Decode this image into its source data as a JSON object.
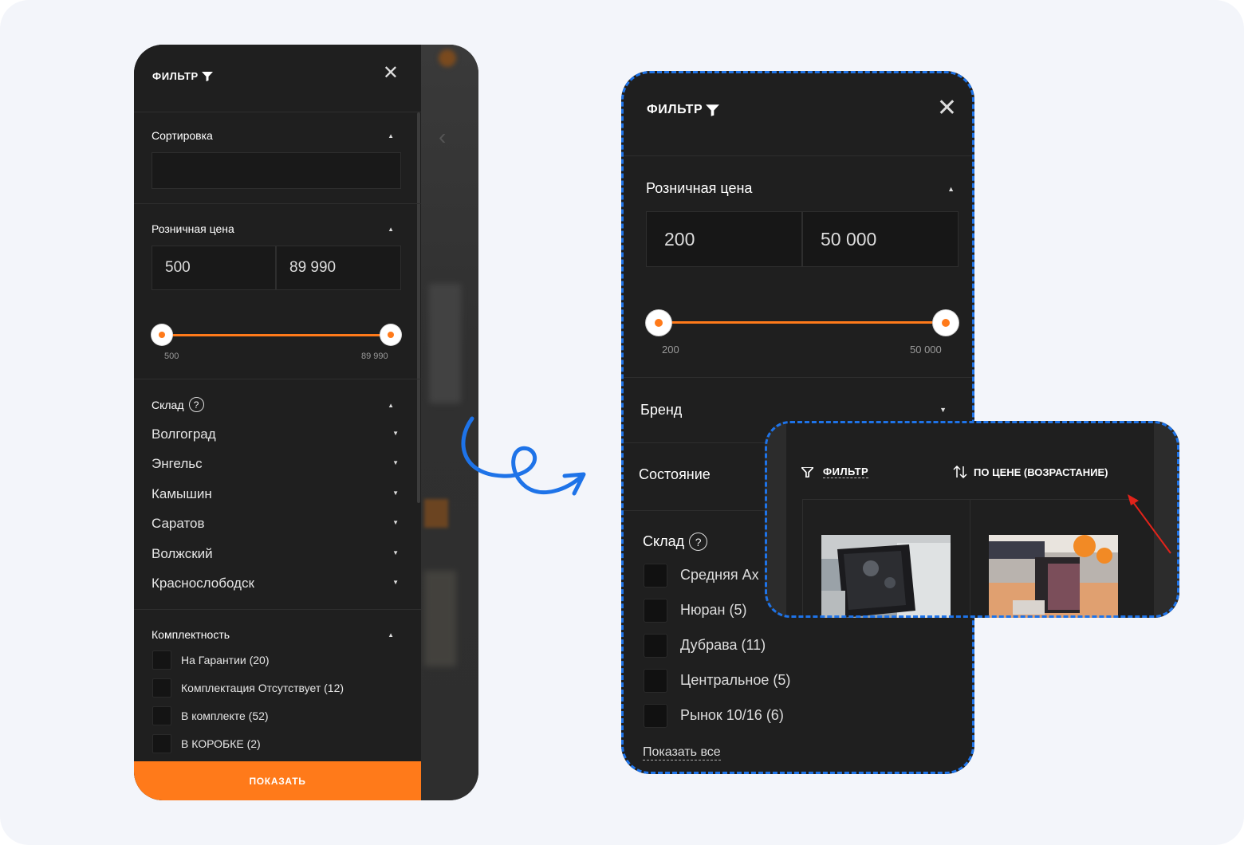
{
  "left": {
    "title": "ФИЛЬТР",
    "sort": {
      "label": "Сортировка",
      "value": ""
    },
    "price": {
      "label": "Розничная цена",
      "min": "500",
      "max": "89 990",
      "min_label": "500",
      "max_label": "89 990"
    },
    "warehouse": {
      "label": "Склад",
      "help": "?",
      "cities": [
        "Волгоград",
        "Энгельс",
        "Камышин",
        "Саратов",
        "Волжский",
        "Краснослободск"
      ]
    },
    "completeness": {
      "label": "Комплектность",
      "options": [
        "На Гарантии (20)",
        "Комплектация Отсутствует (12)",
        "В комплекте (52)",
        "В КОРОБКЕ (2)"
      ]
    },
    "show_button": "ПОКАЗАТЬ"
  },
  "right": {
    "title": "ФИЛЬТР",
    "price": {
      "label": "Розничная цена",
      "min": "200",
      "max": "50 000",
      "min_label": "200",
      "max_label": "50 000"
    },
    "brand": "Бренд",
    "condition": "Состояние",
    "warehouse": {
      "label": "Склад",
      "help": "?",
      "options": [
        "Средняя Ах",
        "Нюран (5)",
        "Дубрава (11)",
        "Центральное (5)",
        "Рынок 10/16 (6)"
      ]
    },
    "show_all": "Показать все"
  },
  "inset": {
    "filter_label": "ФИЛЬТР",
    "sort_label": "ПО ЦЕНЕ (ВОЗРАСТАНИЕ)"
  },
  "colors": {
    "accent": "#ff7a1a",
    "highlight": "#1e73e8",
    "panel": "#1f1f1f"
  }
}
